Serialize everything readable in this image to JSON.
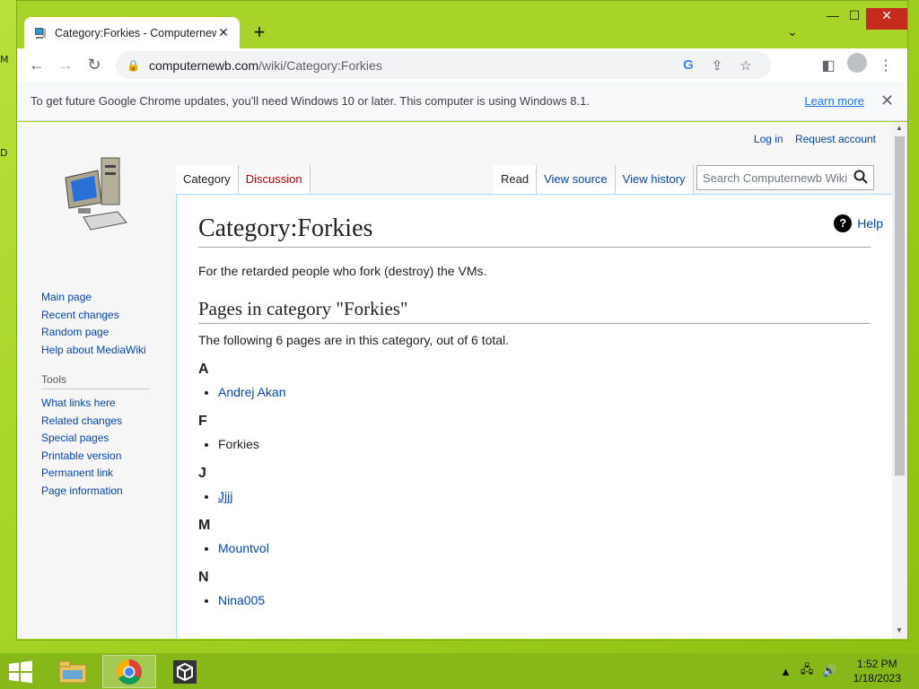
{
  "browser": {
    "tab_title": "Category:Forkies - Computernewb Wiki",
    "url_host": "computernewb.com",
    "url_path": "/wiki/Category:Forkies",
    "infobar_message": "To get future Google Chrome updates, you'll need Windows 10 or later. This computer is using Windows 8.1.",
    "infobar_link": "Learn more"
  },
  "wiki": {
    "personal": [
      "Log in",
      "Request account"
    ],
    "tabs_left": [
      "Category",
      "Discussion"
    ],
    "tabs_right": [
      "Read",
      "View source",
      "View history"
    ],
    "search_placeholder": "Search Computernewb Wiki",
    "help": "Help",
    "title": "Category:Forkies",
    "description": "For the retarded people who fork (destroy) the VMs.",
    "section_title": "Pages in category \"Forkies\"",
    "count_text": "The following 6 pages are in this category, out of 6 total.",
    "groups": [
      {
        "letter": "A",
        "pages": [
          "Andrej Akan"
        ]
      },
      {
        "letter": "F",
        "pages": [
          "Forkies"
        ]
      },
      {
        "letter": "J",
        "pages": [
          "Jjjj"
        ]
      },
      {
        "letter": "M",
        "pages": [
          "Mountvol"
        ]
      },
      {
        "letter": "N",
        "pages": [
          "Nina005"
        ]
      }
    ],
    "nav": [
      "Main page",
      "Recent changes",
      "Random page",
      "Help about MediaWiki"
    ],
    "tools_heading": "Tools",
    "tools": [
      "What links here",
      "Related changes",
      "Special pages",
      "Printable version",
      "Permanent link",
      "Page information"
    ]
  },
  "taskbar": {
    "time": "1:52 PM",
    "date": "1/18/2023"
  },
  "colors": {
    "desktop": "#9ed11f",
    "link": "#0645ad",
    "redlink": "#ba0000"
  }
}
